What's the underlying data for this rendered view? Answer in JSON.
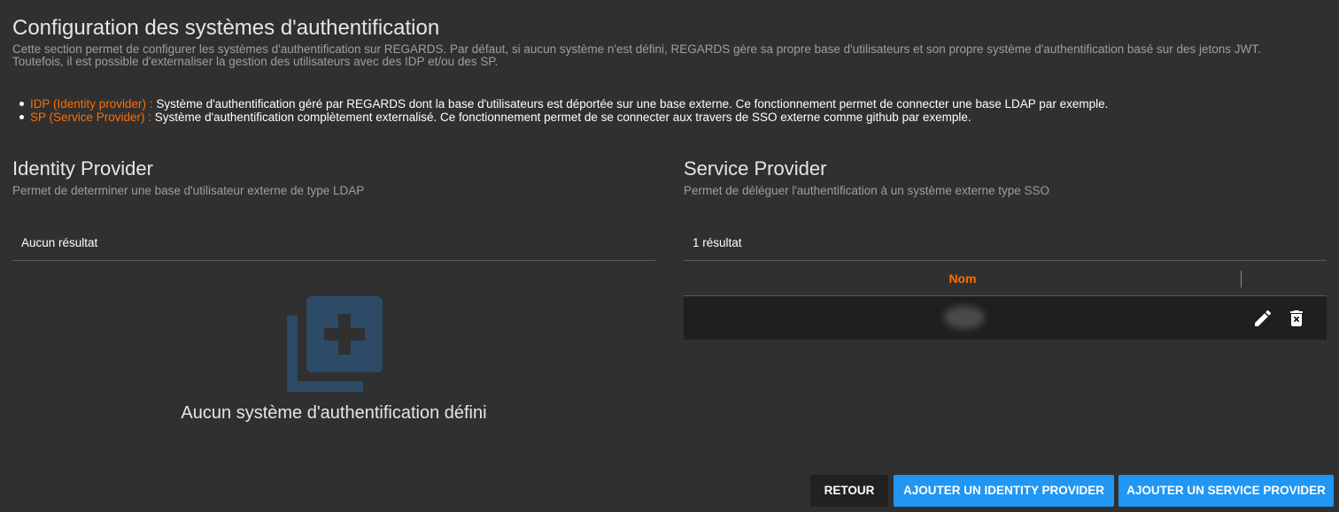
{
  "header": {
    "title": "Configuration des systèmes d'authentification",
    "description": "Cette section permet de configurer les systèmes d'authentification sur REGARDS. Par défaut, si aucun système n'est défini, REGARDS gère sa propre base d'utilisateurs et son propre système d'authentification basé sur des jetons JWT. Toutefois, il est possible d'externaliser la gestion des utilisateurs avec des IDP et/ou des SP."
  },
  "bullets": [
    {
      "term": "IDP (Identity provider) :",
      "text": " Système d'authentification géré par REGARDS dont la base d'utilisateurs est déportée sur une base externe. Ce fonctionnement permet de connecter une base LDAP par exemple."
    },
    {
      "term": "SP (Service Provider) :",
      "text": " Système d'authentification complètement externalisé. Ce fonctionnement permet de se connecter aux travers de SSO externe comme github par exemple."
    }
  ],
  "identity_provider": {
    "title": "Identity Provider",
    "subtitle": "Permet de determiner une base d'utilisateur externe de type LDAP",
    "result_count": "Aucun résultat",
    "empty_message": "Aucun système d'authentification défini",
    "empty_icon": "library-add-icon"
  },
  "service_provider": {
    "title": "Service Provider",
    "subtitle": "Permet de déléguer l'authentification à un système externe type SSO",
    "result_count": "1 résultat",
    "columns": [
      "Nom"
    ],
    "rows": [
      {
        "name": ""
      }
    ]
  },
  "actions": {
    "back": "RETOUR",
    "add_idp": "AJOUTER UN IDENTITY PROVIDER",
    "add_sp": "AJOUTER UN SERVICE PROVIDER"
  },
  "colors": {
    "background": "#303030",
    "accent": "#ff6d00",
    "primary": "#2196f3",
    "icon_muted": "#2d4a66"
  }
}
